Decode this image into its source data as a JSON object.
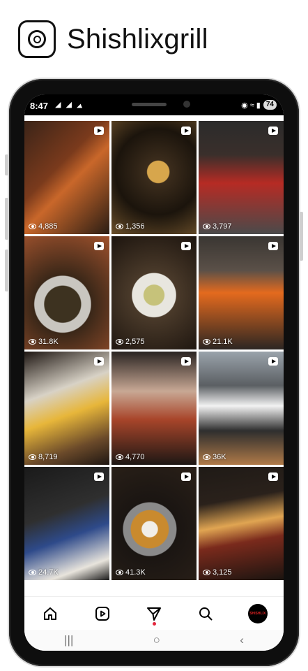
{
  "brand": {
    "name": "Shishlixgrill",
    "logo_icon": "instagram-icon"
  },
  "status_bar": {
    "time": "8:47",
    "left_icons": "◢ ◢ ◢",
    "right_icons": "◉ ≈ ▮",
    "battery": "74"
  },
  "grid": {
    "tiles": [
      {
        "views": "4,885",
        "bg": "linear-gradient(135deg,#3b2418 0%,#7a3a1c 40%,#c9672a 55%,#2a1d14 100%)"
      },
      {
        "views": "1,356",
        "bg": "radial-gradient(circle at 55% 45%,#d7a64c 0 14%,#3b2c1c 15%,#1b140c 55%,#6b4f2a 100%)"
      },
      {
        "views": "3,797",
        "bg": "linear-gradient(180deg,#2b2b2b 0%,#3a2f2b 30%,#b62b24 55%,#4a4a4a 100%)"
      },
      {
        "views": "31.8K",
        "bg": "radial-gradient(circle at 45% 60%,#3d3220 0 22%,#c9c6c0 23% 34%,#3a2718 35%,#a0522d 100%)"
      },
      {
        "views": "2,575",
        "bg": "radial-gradient(circle at 50% 52%,#c6c27a 0 14%,#e8e6df 15% 30%,#4a3a2a 31%,#1c140e 100%)"
      },
      {
        "views": "21.1K",
        "bg": "linear-gradient(180deg,#3a3632 0%,#5a5048 30%,#e46a1e 50%,#2c2622 100%)"
      },
      {
        "views": "8,719",
        "bg": "linear-gradient(160deg,#1e1612 0%,#d8d2c6 35%,#e7b63a 55%,#6b4a2a 80%,#1e1612 100%)"
      },
      {
        "views": "4,770",
        "bg": "linear-gradient(180deg,#2a2422 0%,#c8a894 35%,#a8452a 60%,#1d1714 100%)"
      },
      {
        "views": "36K",
        "bg": "linear-gradient(180deg,#9aa3ab 0%,#5b5f63 30%,#f2f2f2 48%,#2e2e2e 70%,#b07a48 100%)"
      },
      {
        "views": "24.7K",
        "bg": "linear-gradient(160deg,#1a1a1a 0%,#2f2f2f 40%,#2e4a8a 60%,#e8e4dc 85%,#1a1a1a 100%)"
      },
      {
        "views": "41.3K",
        "bg": "radial-gradient(circle at 45% 55%,#f1eee8 0 10%,#c98a2e 11% 24%,#8a8a8a 25% 34%,#1a1512 35%,#2a2018 100%)"
      },
      {
        "views": "3,125",
        "bg": "linear-gradient(170deg,#1f1a16 0%,#2a211b 30%,#e0a552 50%,#7a2a1c 65%,#1a1410 100%)"
      }
    ]
  },
  "bottom_nav": [
    {
      "name": "home",
      "icon": "home-icon"
    },
    {
      "name": "reels",
      "icon": "reels-icon"
    },
    {
      "name": "direct",
      "icon": "send-icon"
    },
    {
      "name": "search",
      "icon": "search-icon"
    },
    {
      "name": "profile",
      "icon": "profile-avatar",
      "label": "SHISHLIX"
    }
  ],
  "system_nav": {
    "recents": "|||",
    "home": "○",
    "back": "‹"
  }
}
